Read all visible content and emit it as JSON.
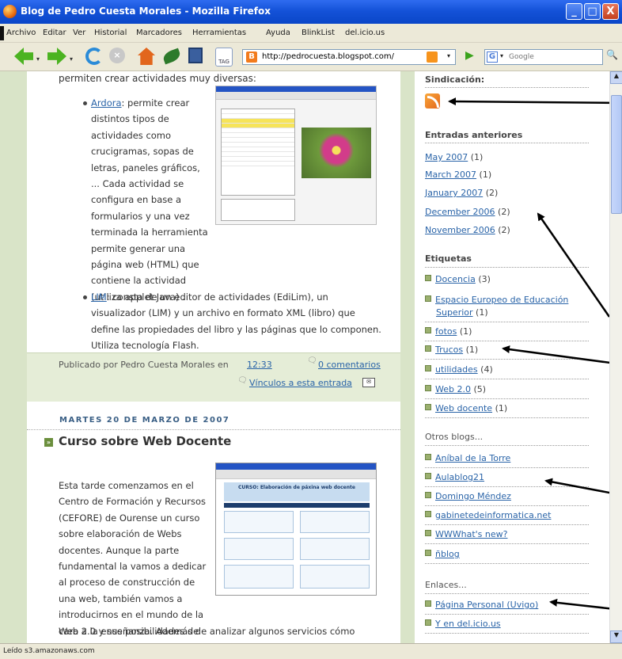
{
  "window": {
    "title": "Blog de Pedro Cuesta Morales - Mozilla Firefox",
    "buttons": {
      "minimize": "_",
      "maximize": "□",
      "close": "X"
    }
  },
  "menu": [
    "Archivo",
    "Editar",
    "Ver",
    "Historial",
    "Marcadores",
    "Herramientas",
    "Ayuda",
    "BlinkList",
    "del.icio.us"
  ],
  "toolbar": {
    "url": "http://pedrocuesta.blogspot.com/",
    "search_placeholder": "Google",
    "tag_label": "TAG",
    "icons": [
      "back-icon",
      "forward-icon",
      "reload-icon",
      "stop-icon",
      "home-icon",
      "leaf-icon",
      "floppy-icon",
      "tag-icon",
      "go-icon",
      "search-icon"
    ]
  },
  "post1": {
    "intro": "permiten crear actividades muy diversas:",
    "item1_link": "Ardora",
    "item1_lines": [
      ": permite crear",
      "distintos tipos de",
      "actividades como",
      "crucigramas, sopas de",
      "letras, paneles gráficos,",
      "... Cada actividad se",
      "configura en base a",
      "formularios y una vez",
      "terminada la herramienta",
      "permite generar una",
      "página web (HTML) que",
      "contiene la actividad",
      "(utiliza applet Java) ."
    ],
    "item2_link": "LIM",
    "item2_lines": [
      ": consta de un editor de actividades (EdiLim), un",
      "visualizador (LIM) y un archivo en formato XML (libro) que",
      "define las propiedades del libro y las páginas que lo componen.",
      "Utiliza tecnología Flash."
    ],
    "footer": {
      "published_by": "Publicado por Pedro Cuesta Morales en",
      "time": "12:33",
      "comments": "0 comentarios",
      "links_to": "Vínculos a esta entrada"
    }
  },
  "post2": {
    "date": "MARTES 20 DE MARZO DE 2007",
    "title": "Curso sobre Web Docente",
    "lines": [
      "Esta tarde comenzamos en el",
      "Centro de Formación y Recursos",
      "(CEFORE) de Ourense un curso",
      "sobre elaboración de Webs",
      "docentes. Aunque la parte",
      "fundamental la vamos a dedicar",
      "al proceso de construcción de",
      "una web, también vamos a",
      "introducirnos en el mundo de la",
      "Web 2.0 y sus posibilidades de"
    ],
    "last_line": "cara a la enseñanza. Además de analizar algunos servicios cómo",
    "screenshot_heading": "CURSO: Elaboración de páxina web docente"
  },
  "sidebar": {
    "syndication_title": "Sindicación:",
    "archive_title": "Entradas anteriores",
    "archive": [
      {
        "label": "May 2007",
        "count": "(1)"
      },
      {
        "label": "March 2007",
        "count": "(1)"
      },
      {
        "label": "January 2007",
        "count": "(2)"
      },
      {
        "label": "December 2006",
        "count": "(2)"
      },
      {
        "label": "November 2006",
        "count": "(2)"
      }
    ],
    "labels_title": "Etiquetas",
    "labels": [
      {
        "label": "Docencia",
        "count": "(3)"
      },
      {
        "label": "Espacio Europeo de Educación",
        "label2": "Superior",
        "count": "(1)"
      },
      {
        "label": "fotos",
        "count": "(1)"
      },
      {
        "label": "Trucos",
        "count": "(1)"
      },
      {
        "label": "utilidades",
        "count": "(4)"
      },
      {
        "label": "Web 2.0",
        "count": "(5)"
      },
      {
        "label": "Web docente",
        "count": "(1)"
      }
    ],
    "blogs_title": "Otros blogs...",
    "blogs": [
      "Aníbal de la Torre",
      "Aulablog21",
      "Domingo Méndez",
      "gabinetedeinformatica.net",
      "WWWhat's new?",
      "ñblog"
    ],
    "links_title": "Enlaces...",
    "links": [
      "Página Personal (Uvigo)",
      "Y en del.icio.us"
    ]
  },
  "status": "Leído s3.amazonaws.com"
}
